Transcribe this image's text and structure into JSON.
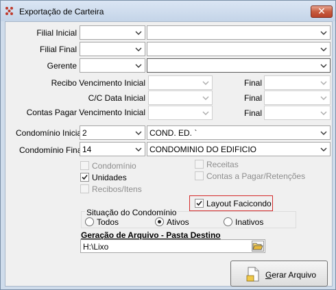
{
  "window": {
    "title": "Exportação de Carteira",
    "close_label": "✕"
  },
  "filters": {
    "filial_inicial_label": "Filial Inicial",
    "filial_final_label": "Filial Final",
    "gerente_label": "Gerente",
    "recibo_label": "Recibo Vencimento Inicial",
    "cc_data_label": "C/C Data Inicial",
    "contas_pagar_label": "Contas Pagar Vencimento Inicial",
    "final_label": "Final",
    "condominio_inicial_label": "Condomínio Inicial",
    "condominio_final_label": "Condomínio Final",
    "condominio_inicial_code": "2",
    "condominio_inicial_name": "COND. ED. `",
    "condominio_final_code": "14",
    "condominio_final_name": "CONDOMINIO DO EDIFICIO"
  },
  "options": {
    "condominio": {
      "label": "Condomínio",
      "checked": false,
      "enabled": false
    },
    "unidades": {
      "label": "Unidades",
      "checked": true,
      "enabled": true
    },
    "recibos_itens": {
      "label": "Recibos/Itens",
      "checked": false,
      "enabled": false
    },
    "receitas": {
      "label": "Receitas",
      "checked": false,
      "enabled": false
    },
    "contas_pagar_retencoes": {
      "label": "Contas a Pagar/Retenções",
      "checked": false,
      "enabled": false
    },
    "layout_facicondo": {
      "label": "Layout Facicondo",
      "checked": true,
      "enabled": true
    }
  },
  "situacao": {
    "title": "Situação do Condomínio",
    "options": [
      "Todos",
      "Ativos",
      "Inativos"
    ],
    "selected": "Ativos"
  },
  "destino": {
    "title": "Geração de Arquivo - Pasta Destino",
    "path": "H:\\Lixo"
  },
  "actions": {
    "gerar_accel": "G",
    "gerar_rest": "erar Arquivo"
  },
  "icons": {
    "app": "app-logo-icon",
    "close": "close-icon",
    "dropdown": "chevron-down-icon",
    "folder": "folder-open-icon",
    "document": "document-icon",
    "checkbox": "checkmark-icon"
  }
}
